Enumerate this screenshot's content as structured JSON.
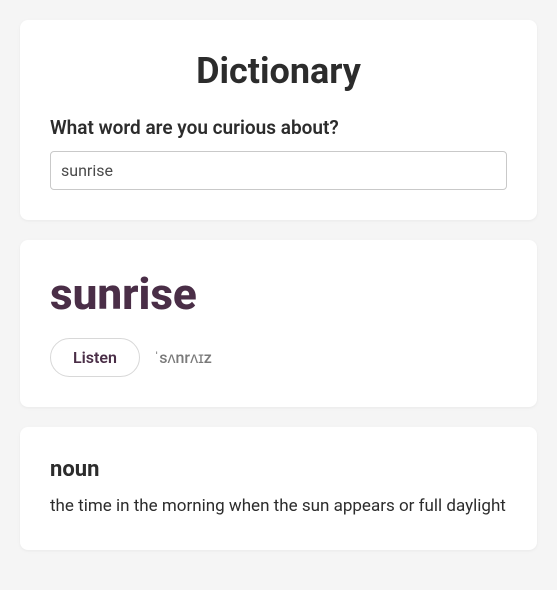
{
  "header": {
    "title": "Dictionary",
    "prompt": "What word are you curious about?",
    "input_value": "sunrise"
  },
  "entry": {
    "word": "sunrise",
    "listen_label": "Listen",
    "ipa": "ˈsʌnrʌɪz"
  },
  "definition": {
    "part_of_speech": "noun",
    "text": "the time in the morning when the sun appears or full daylight"
  }
}
